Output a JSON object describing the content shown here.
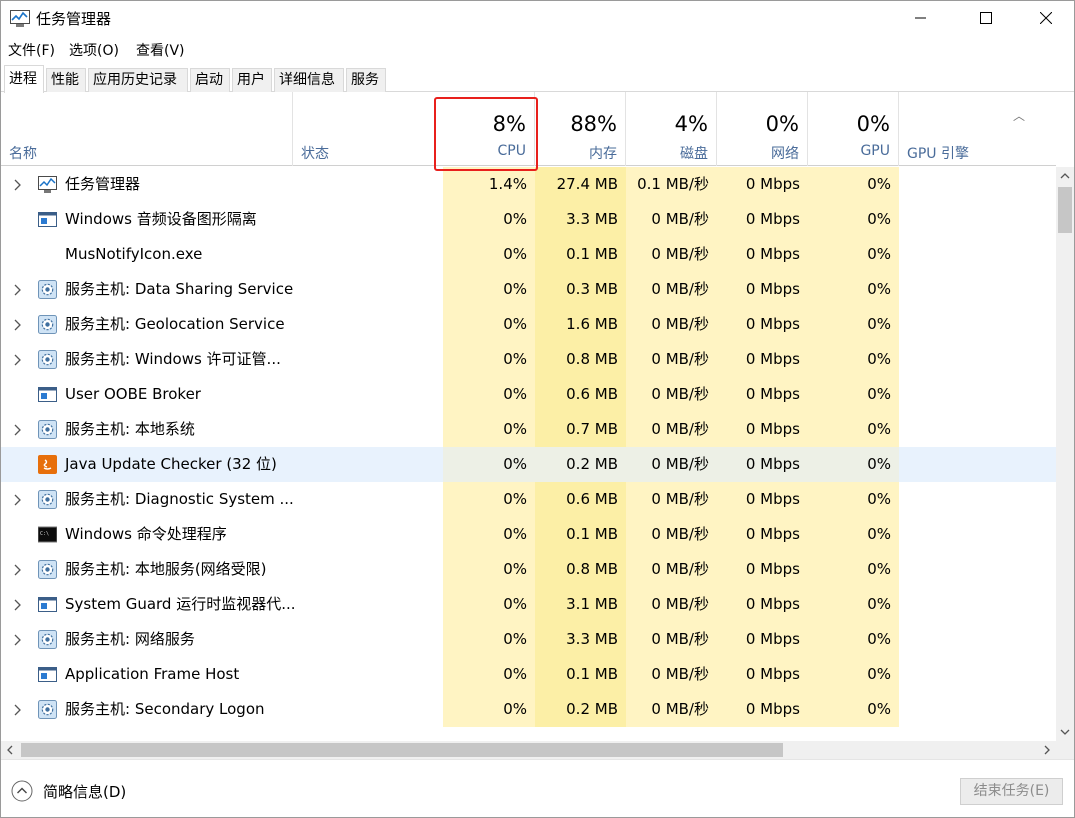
{
  "window": {
    "title": "任务管理器"
  },
  "menu": [
    "文件(F)",
    "选项(O)",
    "查看(V)"
  ],
  "tabs": [
    "进程",
    "性能",
    "应用历史记录",
    "启动",
    "用户",
    "详细信息",
    "服务"
  ],
  "header": {
    "name": "名称",
    "status": "状态",
    "cpu": {
      "pct": "8%",
      "label": "CPU"
    },
    "mem": {
      "pct": "88%",
      "label": "内存"
    },
    "disk": {
      "pct": "4%",
      "label": "磁盘"
    },
    "net": {
      "pct": "0%",
      "label": "网络"
    },
    "gpu": {
      "pct": "0%",
      "label": "GPU"
    },
    "gpu_engine": "GPU 引擎"
  },
  "processes": [
    {
      "name": "任务管理器",
      "icon": "taskmgr-icon",
      "expand": true,
      "cpu": "1.4%",
      "mem": "27.4 MB",
      "disk": "0.1 MB/秒",
      "net": "0 Mbps",
      "gpu": "0%"
    },
    {
      "name": "Windows 音频设备图形隔离",
      "icon": "window-icon",
      "expand": false,
      "cpu": "0%",
      "mem": "3.3 MB",
      "disk": "0 MB/秒",
      "net": "0 Mbps",
      "gpu": "0%"
    },
    {
      "name": "MusNotifyIcon.exe",
      "icon": "",
      "expand": false,
      "cpu": "0%",
      "mem": "0.1 MB",
      "disk": "0 MB/秒",
      "net": "0 Mbps",
      "gpu": "0%"
    },
    {
      "name": "服务主机: Data Sharing Service",
      "icon": "gear-icon",
      "expand": true,
      "cpu": "0%",
      "mem": "0.3 MB",
      "disk": "0 MB/秒",
      "net": "0 Mbps",
      "gpu": "0%"
    },
    {
      "name": "服务主机: Geolocation Service",
      "icon": "gear-icon",
      "expand": true,
      "cpu": "0%",
      "mem": "1.6 MB",
      "disk": "0 MB/秒",
      "net": "0 Mbps",
      "gpu": "0%"
    },
    {
      "name": "服务主机: Windows 许可证管...",
      "icon": "gear-icon",
      "expand": true,
      "cpu": "0%",
      "mem": "0.8 MB",
      "disk": "0 MB/秒",
      "net": "0 Mbps",
      "gpu": "0%"
    },
    {
      "name": "User OOBE Broker",
      "icon": "window-icon",
      "expand": false,
      "cpu": "0%",
      "mem": "0.6 MB",
      "disk": "0 MB/秒",
      "net": "0 Mbps",
      "gpu": "0%"
    },
    {
      "name": "服务主机: 本地系统",
      "icon": "gear-icon",
      "expand": true,
      "cpu": "0%",
      "mem": "0.7 MB",
      "disk": "0 MB/秒",
      "net": "0 Mbps",
      "gpu": "0%"
    },
    {
      "name": "Java Update Checker (32 位)",
      "icon": "java-icon",
      "expand": false,
      "cpu": "0%",
      "mem": "0.2 MB",
      "disk": "0 MB/秒",
      "net": "0 Mbps",
      "gpu": "0%",
      "selected": true
    },
    {
      "name": "服务主机: Diagnostic System ...",
      "icon": "gear-icon",
      "expand": true,
      "cpu": "0%",
      "mem": "0.6 MB",
      "disk": "0 MB/秒",
      "net": "0 Mbps",
      "gpu": "0%"
    },
    {
      "name": "Windows 命令处理程序",
      "icon": "cmd-icon",
      "expand": false,
      "cpu": "0%",
      "mem": "0.1 MB",
      "disk": "0 MB/秒",
      "net": "0 Mbps",
      "gpu": "0%"
    },
    {
      "name": "服务主机: 本地服务(网络受限)",
      "icon": "gear-icon",
      "expand": true,
      "cpu": "0%",
      "mem": "0.8 MB",
      "disk": "0 MB/秒",
      "net": "0 Mbps",
      "gpu": "0%"
    },
    {
      "name": "System Guard 运行时监视器代...",
      "icon": "window-icon",
      "expand": true,
      "cpu": "0%",
      "mem": "3.1 MB",
      "disk": "0 MB/秒",
      "net": "0 Mbps",
      "gpu": "0%"
    },
    {
      "name": "服务主机: 网络服务",
      "icon": "gear-icon",
      "expand": true,
      "cpu": "0%",
      "mem": "3.3 MB",
      "disk": "0 MB/秒",
      "net": "0 Mbps",
      "gpu": "0%"
    },
    {
      "name": "Application Frame Host",
      "icon": "window-icon",
      "expand": false,
      "cpu": "0%",
      "mem": "0.1 MB",
      "disk": "0 MB/秒",
      "net": "0 Mbps",
      "gpu": "0%"
    },
    {
      "name": "服务主机: Secondary Logon",
      "icon": "gear-icon",
      "expand": true,
      "cpu": "0%",
      "mem": "0.2 MB",
      "disk": "0 MB/秒",
      "net": "0 Mbps",
      "gpu": "0%"
    }
  ],
  "footer": {
    "fewer_details": "简略信息(D)",
    "end_task": "结束任务(E)"
  },
  "colors": {
    "cpu_highlight_border": "#e8201c",
    "col_light": "#fff4c3",
    "col_mem": "#fcefa6",
    "selected_row": "#e8f2fd",
    "header_label": "#4a6c9a"
  }
}
